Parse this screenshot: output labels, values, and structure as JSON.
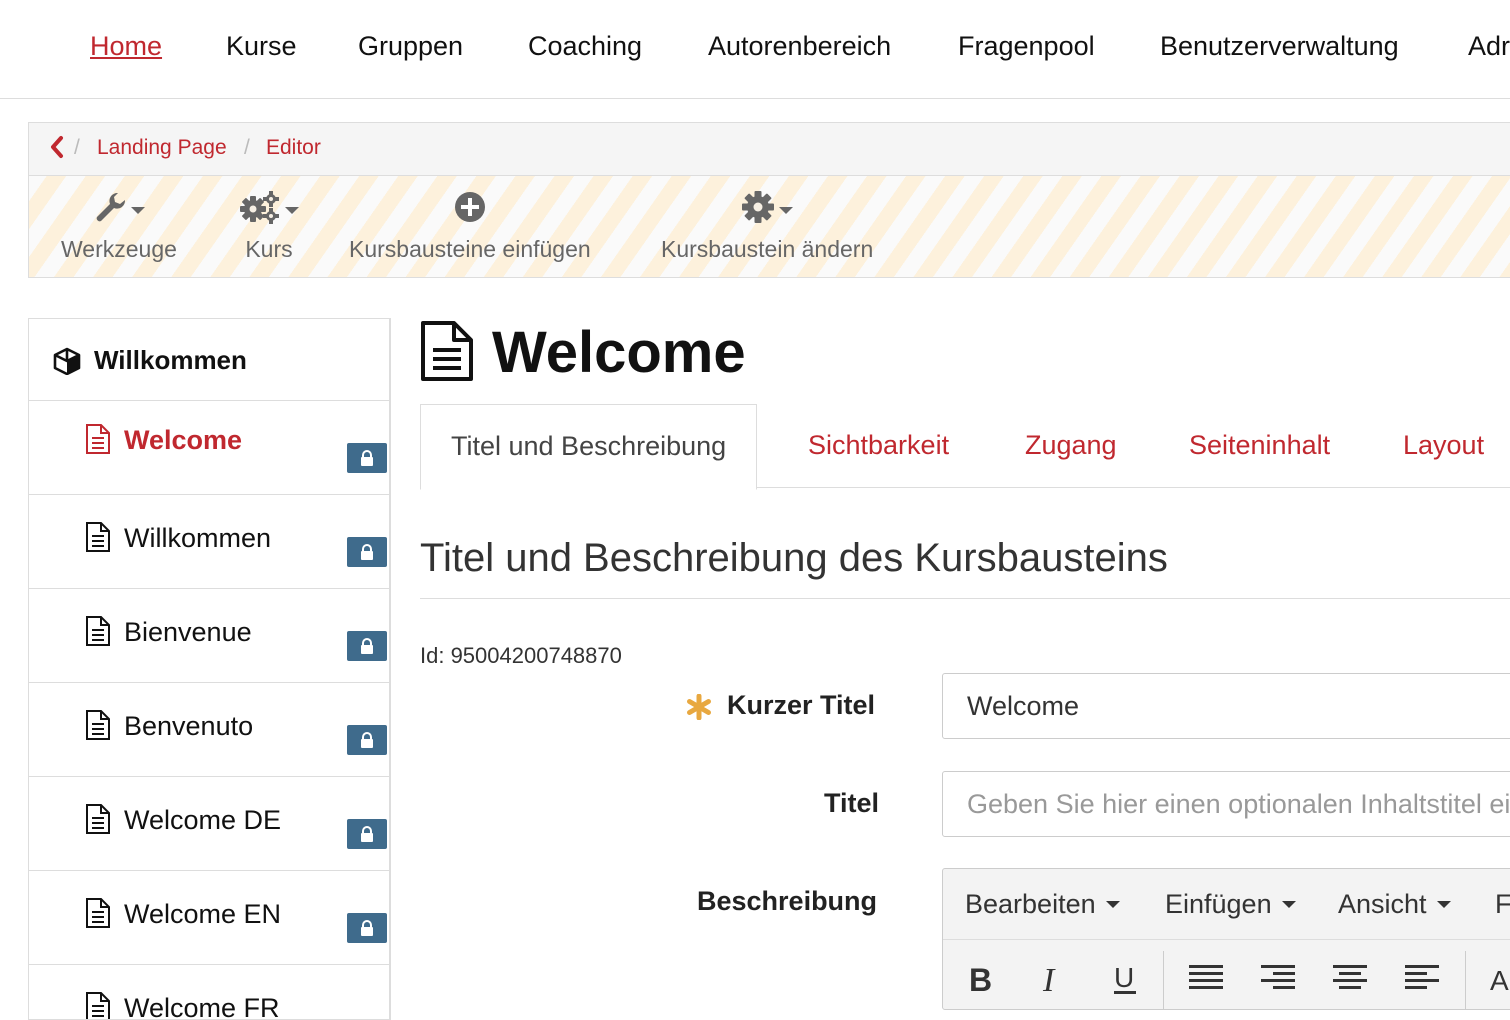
{
  "topnav": {
    "items": [
      {
        "label": "Home",
        "active": true
      },
      {
        "label": "Kurse"
      },
      {
        "label": "Gruppen"
      },
      {
        "label": "Coaching"
      },
      {
        "label": "Autorenbereich"
      },
      {
        "label": "Fragenpool"
      },
      {
        "label": "Benutzerverwaltung"
      },
      {
        "label": "Adr"
      }
    ]
  },
  "breadcrumb": {
    "items": [
      "Landing Page",
      "Editor"
    ],
    "separator": "/"
  },
  "toolbar": {
    "werkzeuge": "Werkzeuge",
    "kurs": "Kurs",
    "einfuegen": "Kursbausteine einfügen",
    "aendern": "Kursbaustein ändern"
  },
  "sidebar": {
    "root": "Willkommen",
    "items": [
      {
        "label": "Welcome",
        "active": true
      },
      {
        "label": "Willkommen"
      },
      {
        "label": "Bienvenue"
      },
      {
        "label": "Benvenuto"
      },
      {
        "label": "Welcome DE"
      },
      {
        "label": "Welcome EN"
      },
      {
        "label": "Welcome FR"
      }
    ]
  },
  "page": {
    "title": "Welcome"
  },
  "tabs": [
    {
      "label": "Titel und Beschreibung",
      "active": true
    },
    {
      "label": "Sichtbarkeit"
    },
    {
      "label": "Zugang"
    },
    {
      "label": "Seiteninhalt"
    },
    {
      "label": "Layout"
    }
  ],
  "section": {
    "title": "Titel und Beschreibung des Kursbausteins",
    "id_text": "Id: 95004200748870"
  },
  "form": {
    "short_title_label": "Kurzer Titel",
    "short_title_value": "Welcome",
    "title_label": "Titel",
    "title_placeholder": "Geben Sie hier einen optionalen Inhaltstitel ein",
    "description_label": "Beschreibung"
  },
  "editor": {
    "menus": [
      "Bearbeiten",
      "Einfügen",
      "Ansicht",
      "F"
    ]
  },
  "colors": {
    "accent": "#c0282f",
    "lock_badge": "#3f6b8c",
    "required_star": "#e8a840"
  }
}
